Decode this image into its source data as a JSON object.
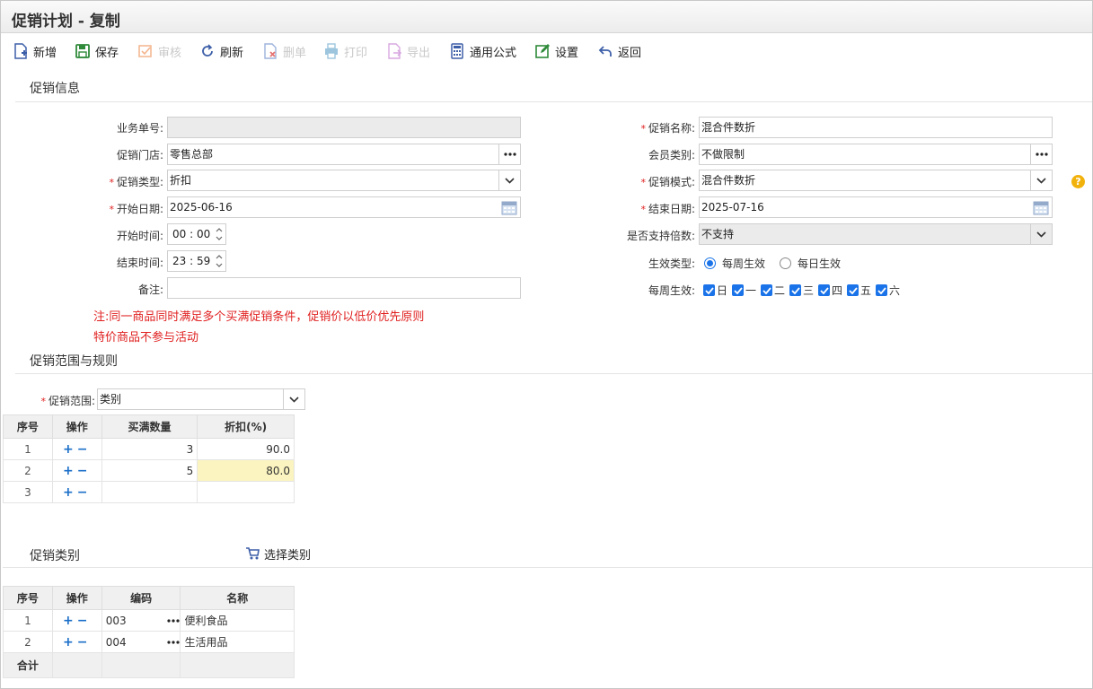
{
  "window": {
    "title": "促销计划 - 复制"
  },
  "toolbar": {
    "new": "新增",
    "save": "保存",
    "audit": "审核",
    "refresh": "刷新",
    "delete": "删单",
    "print": "打印",
    "export": "导出",
    "formula": "通用公式",
    "settings": "设置",
    "back": "返回"
  },
  "sections": {
    "info": "促销信息",
    "scope": "促销范围与规则",
    "category": "促销类别",
    "select_category": "选择类别"
  },
  "form": {
    "doc_no": {
      "label": "业务单号:",
      "value": ""
    },
    "store": {
      "label": "促销门店:",
      "value": "零售总部"
    },
    "type": {
      "label": "促销类型:",
      "value": "折扣"
    },
    "start_date": {
      "label": "开始日期:",
      "value": "2025-06-16"
    },
    "start_time": {
      "label": "开始时间:",
      "value": "00 : 00"
    },
    "end_time": {
      "label": "结束时间:",
      "value": "23 : 59"
    },
    "remark": {
      "label": "备注:",
      "value": ""
    },
    "name": {
      "label": "促销名称:",
      "value": "混合件数折"
    },
    "member": {
      "label": "会员类别:",
      "value": "不做限制"
    },
    "mode": {
      "label": "促销模式:",
      "value": "混合件数折"
    },
    "end_date": {
      "label": "结束日期:",
      "value": "2025-07-16"
    },
    "multiple": {
      "label": "是否支持倍数:",
      "value": "不支持"
    },
    "effect_type": {
      "label": "生效类型:",
      "opt1": "每周生效",
      "opt2": "每日生效"
    },
    "weekly": {
      "label": "每周生效:",
      "days": [
        "日",
        "一",
        "二",
        "三",
        "四",
        "五",
        "六"
      ]
    },
    "scope": {
      "label": "促销范围:",
      "value": "类别"
    }
  },
  "notes": {
    "line1": "注:同一商品同时满足多个买满促销条件，促销价以低价优先原则",
    "line2": "特价商品不参与活动"
  },
  "rule_table": {
    "headers": [
      "序号",
      "操作",
      "买满数量",
      "折扣(%)"
    ],
    "rows": [
      {
        "no": "1",
        "qty": "3",
        "discount": "90.0"
      },
      {
        "no": "2",
        "qty": "5",
        "discount": "80.0"
      },
      {
        "no": "3",
        "qty": "",
        "discount": ""
      }
    ]
  },
  "category_table": {
    "headers": [
      "序号",
      "操作",
      "编码",
      "名称"
    ],
    "rows": [
      {
        "no": "1",
        "code": "003",
        "name": "便利食品"
      },
      {
        "no": "2",
        "code": "004",
        "name": "生活用品"
      }
    ],
    "total": "合计"
  },
  "colors": {
    "accent": "#1a73e8",
    "note": "#e02020",
    "highlight": "#fbf4c0"
  }
}
